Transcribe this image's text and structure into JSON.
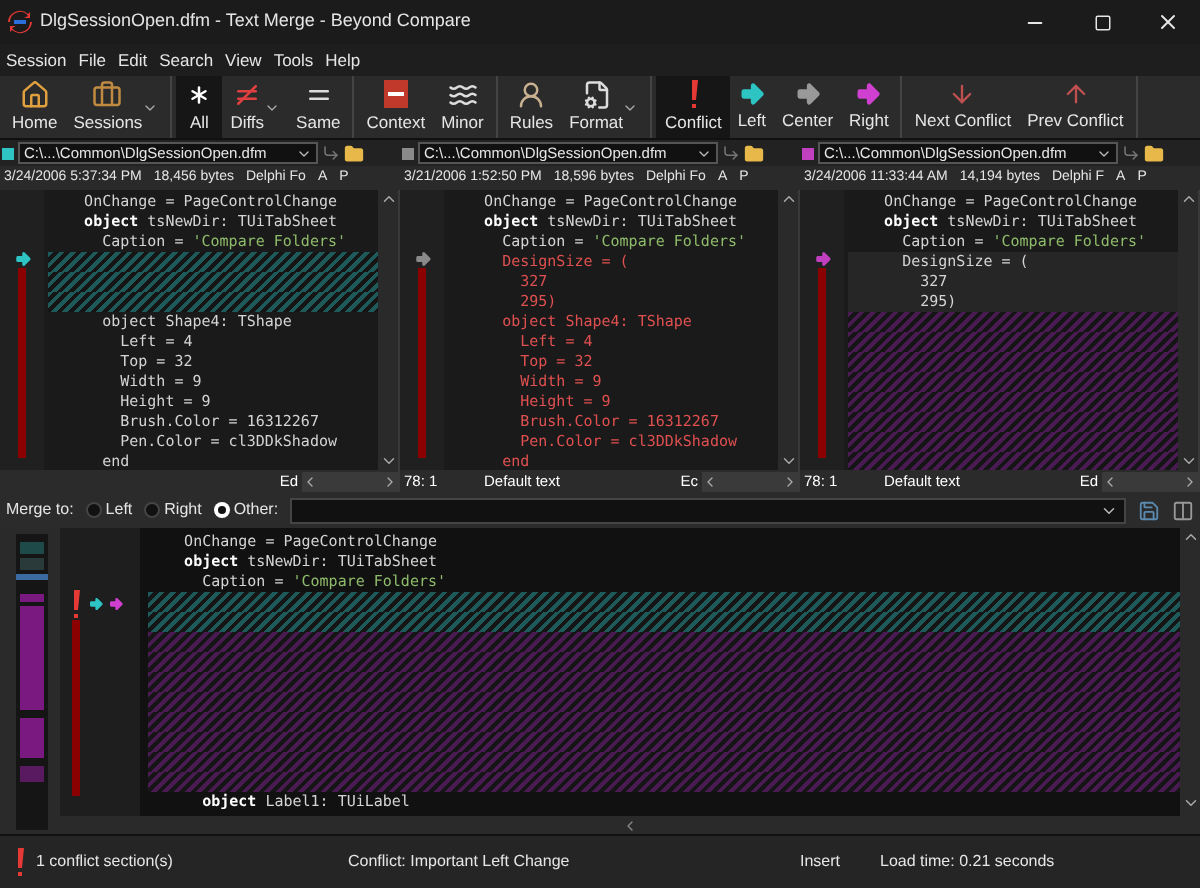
{
  "window": {
    "title": "DlgSessionOpen.dfm - Text Merge - Beyond Compare"
  },
  "menu": [
    "Session",
    "File",
    "Edit",
    "Search",
    "View",
    "Tools",
    "Help"
  ],
  "toolbar": [
    [
      {
        "label": "Home",
        "selected": false,
        "dropdown": false
      },
      {
        "label": "Sessions",
        "selected": false,
        "dropdown": true
      }
    ],
    [
      {
        "label": "All",
        "selected": true,
        "dropdown": false
      },
      {
        "label": "Diffs",
        "selected": false,
        "dropdown": true
      },
      {
        "label": "Same",
        "selected": false,
        "dropdown": false
      }
    ],
    [
      {
        "label": "Context",
        "selected": false,
        "dropdown": false
      },
      {
        "label": "Minor",
        "selected": false,
        "dropdown": false
      }
    ],
    [
      {
        "label": "Rules",
        "selected": false,
        "dropdown": false
      },
      {
        "label": "Format",
        "selected": false,
        "dropdown": true
      }
    ],
    [
      {
        "label": "Conflict",
        "selected": true,
        "dropdown": false
      },
      {
        "label": "Left",
        "selected": false,
        "dropdown": false
      },
      {
        "label": "Center",
        "selected": false,
        "dropdown": false
      },
      {
        "label": "Right",
        "selected": false,
        "dropdown": false
      }
    ],
    [
      {
        "label": "Next Conflict",
        "selected": false,
        "dropdown": false
      },
      {
        "label": "Prev Conflict",
        "selected": false,
        "dropdown": false
      }
    ]
  ],
  "panes": [
    {
      "color": "#2ec4c4",
      "path": "C:\\...\\Common\\DlgSessionOpen.dfm",
      "date": "3/24/2006 5:37:34 PM",
      "size": "18,456 bytes",
      "format": "Delphi Fo",
      "flag_1": "A",
      "flag_2": "P",
      "lines": [
        {
          "kind": "text",
          "text": "    OnChange = PageControlChange"
        },
        {
          "kind": "text",
          "keyword": "    object",
          "text": " tsNewDir: TUiTabSheet"
        },
        {
          "kind": "text",
          "text": "      Caption = ",
          "literal": "'Compare Folders'"
        },
        {
          "kind": "hatch",
          "color": "#1f5a5a"
        },
        {
          "kind": "hatch",
          "color": "#1f5a5a"
        },
        {
          "kind": "hatch",
          "color": "#1f5a5a"
        },
        {
          "kind": "text",
          "text": "      object Shape4: TShape"
        },
        {
          "kind": "text",
          "text": "        Left = 4"
        },
        {
          "kind": "text",
          "text": "        Top = 32"
        },
        {
          "kind": "text",
          "text": "        Width = 9"
        },
        {
          "kind": "text",
          "text": "        Height = 9"
        },
        {
          "kind": "text",
          "text": "        Brush.Color = 16312267"
        },
        {
          "kind": "text",
          "text": "        Pen.Color = cl3DDkShadow"
        },
        {
          "kind": "text",
          "text": "      end"
        }
      ],
      "edit": "Ed"
    },
    {
      "color": "#8a8a8a",
      "path": "C:\\...\\Common\\DlgSessionOpen.dfm",
      "date": "3/21/2006 1:52:50 PM",
      "size": "18,596 bytes",
      "format": "Delphi Fo",
      "flag_1": "A",
      "flag_2": "P",
      "lines": [
        {
          "kind": "text",
          "text": "    OnChange = PageControlChange"
        },
        {
          "kind": "text",
          "keyword": "    object",
          "text": " tsNewDir: TUiTabSheet"
        },
        {
          "kind": "text",
          "text": "      Caption = ",
          "literal": "'Compare Folders'"
        },
        {
          "kind": "changed",
          "text": "      DesignSize = ("
        },
        {
          "kind": "changed",
          "text": "        327"
        },
        {
          "kind": "changed",
          "text": "        295)"
        },
        {
          "kind": "changed",
          "text": "      object Shape4: TShape"
        },
        {
          "kind": "changed",
          "text": "        Left = 4"
        },
        {
          "kind": "changed",
          "text": "        Top = 32"
        },
        {
          "kind": "changed",
          "text": "        Width = 9"
        },
        {
          "kind": "changed",
          "text": "        Height = 9"
        },
        {
          "kind": "changed",
          "text": "        Brush.Color = 16312267"
        },
        {
          "kind": "changed",
          "text": "        Pen.Color = cl3DDkShadow"
        },
        {
          "kind": "changed",
          "text": "      end"
        }
      ],
      "position": "78: 1",
      "syntax": "Default text",
      "edit": "Ec"
    },
    {
      "color": "#c040c0",
      "path": "C:\\...\\Common\\DlgSessionOpen.dfm",
      "date": "3/24/2006 11:33:44 AM",
      "size": "14,194 bytes",
      "format": "Delphi F",
      "flag_1": "A",
      "flag_2": "P",
      "lines": [
        {
          "kind": "text",
          "text": "    OnChange = PageControlChange"
        },
        {
          "kind": "text",
          "keyword": "    object",
          "text": " tsNewDir: TUiTabSheet"
        },
        {
          "kind": "text",
          "text": "      Caption = ",
          "literal": "'Compare Folders'"
        },
        {
          "kind": "inserted",
          "text": "      DesignSize = ("
        },
        {
          "kind": "inserted",
          "text": "        327"
        },
        {
          "kind": "inserted",
          "text": "        295)"
        },
        {
          "kind": "hatch",
          "color": "#4a1a52"
        },
        {
          "kind": "hatch",
          "color": "#4a1a52"
        },
        {
          "kind": "hatch",
          "color": "#4a1a52"
        },
        {
          "kind": "hatch",
          "color": "#4a1a52"
        },
        {
          "kind": "hatch",
          "color": "#4a1a52"
        },
        {
          "kind": "hatch",
          "color": "#4a1a52"
        },
        {
          "kind": "hatch",
          "color": "#4a1a52"
        },
        {
          "kind": "hatch",
          "color": "#4a1a52"
        }
      ],
      "position": "78: 1",
      "syntax": "Default text",
      "edit": "Ed"
    }
  ],
  "merge_to": {
    "label": "Merge to:",
    "options": [
      {
        "label": "Left",
        "selected": false
      },
      {
        "label": "Right",
        "selected": false
      },
      {
        "label": "Other:",
        "selected": true
      }
    ]
  },
  "output": {
    "lines": [
      {
        "kind": "text",
        "text": "    OnChange = PageControlChange"
      },
      {
        "kind": "text",
        "keyword": "    object",
        "text": " tsNewDir: TUiTabSheet"
      },
      {
        "kind": "text",
        "text": "      Caption = ",
        "literal": "'Compare Folders'"
      },
      {
        "kind": "hatch",
        "color": "#1f5a5a"
      },
      {
        "kind": "hatch",
        "color": "#1f5a5a"
      },
      {
        "kind": "hatch",
        "color": "#4a1a52"
      },
      {
        "kind": "hatch",
        "color": "#4a1a52"
      },
      {
        "kind": "hatch",
        "color": "#4a1a52"
      },
      {
        "kind": "hatch",
        "color": "#4a1a52"
      },
      {
        "kind": "hatch",
        "color": "#4a1a52"
      },
      {
        "kind": "hatch",
        "color": "#4a1a52"
      },
      {
        "kind": "hatch",
        "color": "#4a1a52"
      },
      {
        "kind": "hatch",
        "color": "#4a1a52"
      },
      {
        "kind": "text",
        "keyword": "      object",
        "text": " Label1: TUiLabel"
      }
    ]
  },
  "status_bar": {
    "conflicts": "1 conflict section(s)",
    "conflict": "Conflict: Important Left Change",
    "mode": "Insert",
    "load_time": "Load time: 0.21 seconds"
  }
}
